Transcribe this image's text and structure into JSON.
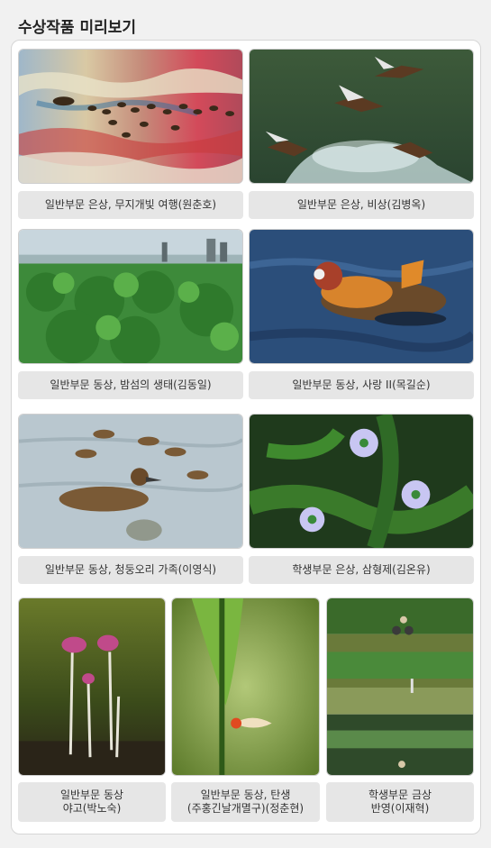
{
  "page_title": "수상작품 미리보기",
  "works": [
    {
      "caption": "일반부문 은상, 무지개빛 여행(원춘호)",
      "image": "ducklings-rainbow-reflection-photo"
    },
    {
      "caption": "일반부문 은상, 비상(김병옥)",
      "image": "mandarin-ducks-flying-photo"
    },
    {
      "caption": "일반부문 동상, 밤섬의 생태(김동일)",
      "image": "bamseom-island-green-photo"
    },
    {
      "caption": "일반부문 동상, 사랑 II(목길순)",
      "image": "mandarin-duck-pair-photo"
    },
    {
      "caption": "일반부문 동상, 청둥오리 가족(이영식)",
      "image": "mallard-family-photo"
    },
    {
      "caption": "학생부문 은상, 삼형제(김온유)",
      "image": "purple-star-flowers-photo"
    },
    {
      "caption_line1": "일반부문 동상",
      "caption_line2": "야고(박노숙)",
      "image": "yago-flowers-photo"
    },
    {
      "caption_line1": "일반부문 동상, 탄생",
      "caption_line2": "(주홍긴날개멸구)(정춘현)",
      "image": "planthopper-on-leaf-photo"
    },
    {
      "caption_line1": "학생부문 금상",
      "caption_line2": "반영(이재혁)",
      "image": "cyclist-reflection-photo"
    }
  ],
  "colors": {
    "background": "#f1f1f1",
    "panel": "#ffffff",
    "caption_bg": "#e6e6e6"
  }
}
